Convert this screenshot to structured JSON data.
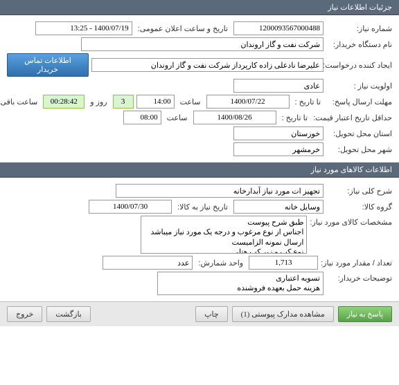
{
  "headers": {
    "need_info": "جزئیات اطلاعات نیاز",
    "goods_info": "اطلاعات کالاهای مورد نیاز"
  },
  "fields": {
    "need_number_label": "شماره نیاز:",
    "need_number": "1200093567000488",
    "public_announce_label": "تاریخ و ساعت اعلان عمومی:",
    "public_announce": "1400/07/19 - 13:25",
    "buyer_org_label": "نام دستگاه خریدار:",
    "buyer_org": "شرکت نفت و گاز اروندان",
    "creator_label": "ایجاد کننده درخواست:",
    "creator": "علیرضا نادعلی زاده کارپرداز شرکت نفت و گاز اروندان",
    "contact_btn": "اطلاعات تماس خریدار",
    "priority_label": "اولویت نیاز :",
    "priority": "عادی",
    "deadline_label": "مهلت ارسال پاسخ:",
    "to_date_label": "تا تاریخ :",
    "deadline_date": "1400/07/22",
    "time_label": "ساعت",
    "deadline_time": "14:00",
    "days_remaining": "3",
    "days_and_label": "روز و",
    "time_remaining": "00:28:42",
    "remaining_label": "ساعت باقی مانده",
    "price_validity_label": "حداقل تاریخ اعتبار قیمت:",
    "price_validity_date": "1400/08/26",
    "price_validity_time": "08:00",
    "province_label": "استان محل تحویل:",
    "province": "خوزستان",
    "city_label": "شهر محل تحویل:",
    "city": "خرمشهر",
    "desc_label": "شرح کلی نیاز:",
    "desc": "تجهیز ات مورد نیاز آبدارخانه",
    "group_label": "گروه کالا:",
    "group": "وسایل خانه",
    "need_date_label": "تاریخ نیاز به کالا:",
    "need_date": "1400/07/30",
    "spec_label": "مشخصات کالای مورد نیاز:",
    "spec": "طبق شرح پیوست\nاجناس از نوع مرغوب و درجه یک مورد نیاز میباشد\nارسال نمونه الزامیست\nنوع کپ و زیر کپ هتلی",
    "qty_label": "تعداد / مقدار مورد نیاز:",
    "qty": "1,713",
    "unit_label": "واحد شمارش:",
    "unit": "عدد",
    "buyer_note_label": "توضیحات خریدار:",
    "buyer_note": "تسویه اعتباری\nهزینه حمل بعهده فروشنده"
  },
  "footer": {
    "respond": "پاسخ به نیاز",
    "attachments": "مشاهده مدارک پیوستی (1)",
    "print": "چاپ",
    "back": "بازگشت",
    "exit": "خروج"
  }
}
